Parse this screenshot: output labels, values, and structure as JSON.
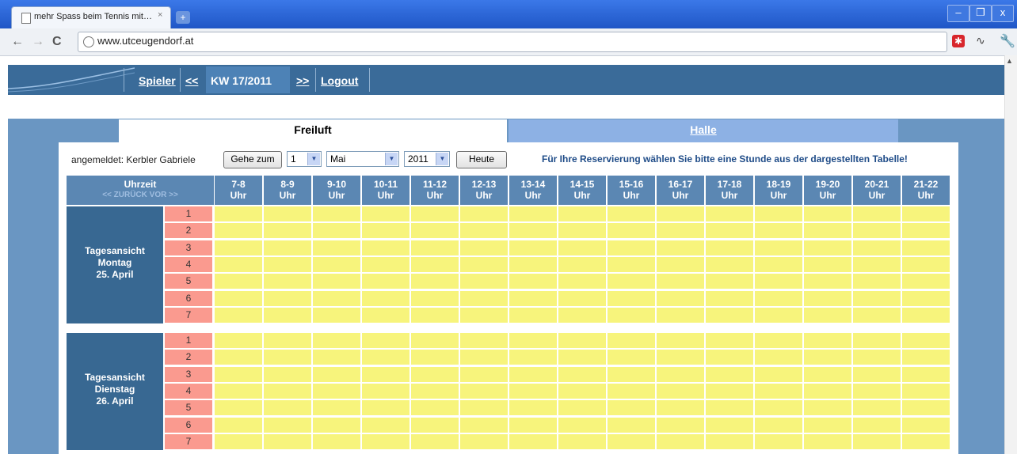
{
  "browser": {
    "tab_title": "mehr Spass beim Tennis mit…",
    "tab_close": "×",
    "new_tab": "+",
    "url": "www.utceugendorf.at",
    "win_minimize": "–",
    "win_maximize": "❐",
    "win_close": "x"
  },
  "topnav": {
    "spieler": "Spieler",
    "prev": "<<",
    "week": "KW 17/2011",
    "next": ">>",
    "logout": "Logout"
  },
  "tabs": {
    "freiluft": "Freiluft",
    "halle": "Halle"
  },
  "controls": {
    "logged_in": "angemeldet: Kerbler Gabriele",
    "goto_button": "Gehe zum",
    "day_value": "1",
    "month_value": "Mai",
    "year_value": "2011",
    "today_button": "Heute",
    "info": "Für Ihre Reservierung wählen Sie bitte eine Stunde aus der dargestellten Tabelle!"
  },
  "grid": {
    "time_header": "Uhrzeit",
    "time_nav": "<< ZURÜCK   VOR >>",
    "hours": [
      "7-8",
      "8-9",
      "9-10",
      "10-11",
      "11-12",
      "12-13",
      "13-14",
      "14-15",
      "15-16",
      "16-17",
      "17-18",
      "18-19",
      "19-20",
      "20-21",
      "21-22"
    ],
    "hour_unit": "Uhr",
    "courts": [
      "1",
      "2",
      "3",
      "4",
      "5",
      "6",
      "7"
    ],
    "days": [
      {
        "line1": "Tagesansicht",
        "line2": "Montag",
        "line3": "25. April"
      },
      {
        "line1": "Tagesansicht",
        "line2": "Dienstag",
        "line3": "26. April"
      }
    ]
  },
  "colors": {
    "slot_free": "#f7f47c",
    "court_label": "#fa9a8f",
    "day_label": "#386892",
    "header": "#5b87b3"
  }
}
